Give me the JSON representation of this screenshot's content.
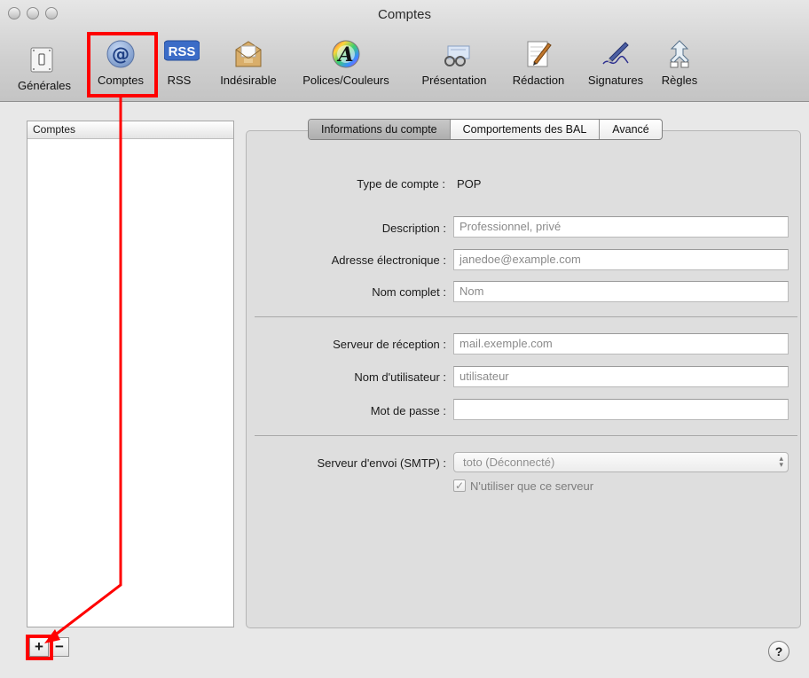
{
  "window": {
    "title": "Comptes"
  },
  "toolbar": {
    "items": [
      {
        "label": "Générales",
        "icon": "switch-icon"
      },
      {
        "label": "Comptes",
        "icon": "at-sign-icon",
        "glyph": "@"
      },
      {
        "label": "RSS",
        "icon": "rss-icon",
        "glyph": "RSS"
      },
      {
        "label": "Indésirable",
        "icon": "junk-mail-icon"
      },
      {
        "label": "Polices/Couleurs",
        "icon": "color-wheel-font-icon",
        "glyph": "A"
      },
      {
        "label": "Présentation",
        "icon": "glasses-icon"
      },
      {
        "label": "Rédaction",
        "icon": "pencil-note-icon"
      },
      {
        "label": "Signatures",
        "icon": "signature-pen-icon"
      },
      {
        "label": "Règles",
        "icon": "rules-arrows-icon"
      }
    ]
  },
  "sidebar": {
    "header": "Comptes",
    "add_label": "+",
    "remove_label": "−"
  },
  "tabs": [
    {
      "label": "Informations du compte",
      "active": true
    },
    {
      "label": "Comportements des BAL",
      "active": false
    },
    {
      "label": "Avancé",
      "active": false
    }
  ],
  "form": {
    "type_label": "Type de compte :",
    "type_value": "POP",
    "description_label": "Description :",
    "description_placeholder": "Professionnel, privé",
    "email_label": "Adresse électronique :",
    "email_placeholder": "janedoe@example.com",
    "fullname_label": "Nom complet :",
    "fullname_placeholder": "Nom",
    "incoming_label": "Serveur de réception :",
    "incoming_placeholder": "mail.exemple.com",
    "username_label": "Nom d'utilisateur :",
    "username_placeholder": "utilisateur",
    "password_label": "Mot de passe :",
    "password_value": "",
    "smtp_label": "Serveur d'envoi (SMTP) :",
    "smtp_value": "toto (Déconnecté)",
    "only_server_label": "N'utiliser que ce serveur",
    "only_server_checked": true
  },
  "help": {
    "label": "?"
  },
  "annotation_color": "#ff0000"
}
